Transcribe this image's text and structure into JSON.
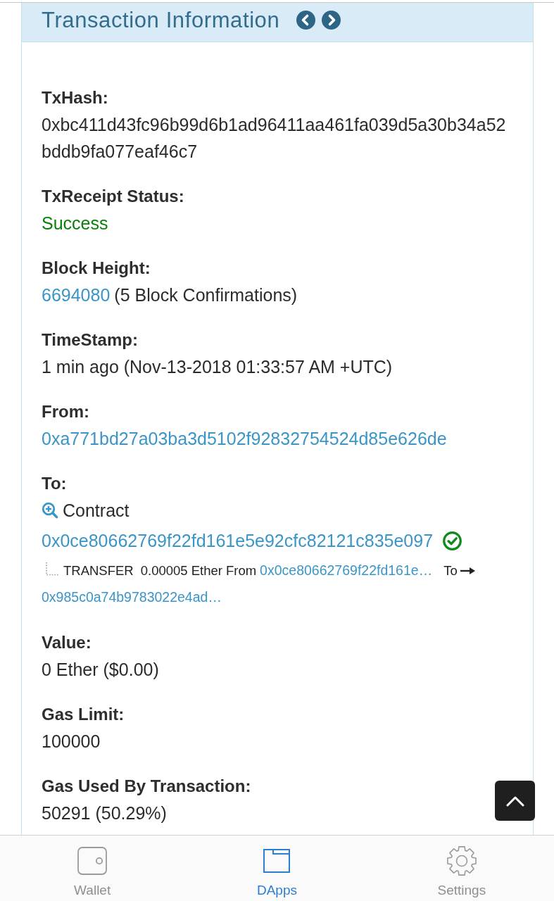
{
  "panel": {
    "title": "Transaction Information"
  },
  "fields": [
    {
      "kind": "text",
      "label": "TxHash:",
      "value": "0xbc411d43fc96b99d6b1ad96411aa461fa039d5a30b34a52bddb9fa077eaf46c7"
    },
    {
      "kind": "status",
      "label": "TxReceipt Status:",
      "value": "Success"
    },
    {
      "kind": "block",
      "label": "Block Height:",
      "link": "6694080",
      "note": "(5 Block Confirmations)"
    },
    {
      "kind": "text",
      "label": "TimeStamp:",
      "value": "1 min ago (Nov-13-2018 01:33:57 AM +UTC)"
    },
    {
      "kind": "address",
      "label": "From:",
      "link": "0xa771bd27a03ba3d5102f92832754524d85e626de"
    },
    {
      "kind": "contract",
      "label": "To:",
      "contract_label": "Contract",
      "link": "0x0ce80662769f22fd161e5e92cfc82121c835e097",
      "verified": true,
      "transfer": {
        "type": "TRANSFER",
        "amount": "0.00005 Ether",
        "from_label": "From",
        "from": "0x0ce80662769f22fd161e…",
        "to_label": "To",
        "to": "0x985c0a74b9783022e4ad…"
      }
    },
    {
      "kind": "text",
      "label": "Value:",
      "value": "0 Ether ($0.00)"
    },
    {
      "kind": "text",
      "label": "Gas Limit:",
      "value": "100000"
    },
    {
      "kind": "text",
      "label": "Gas Used By Transaction:",
      "value": "50291 (50.29%)"
    }
  ],
  "tabs": [
    {
      "label": "Wallet",
      "selected": false
    },
    {
      "label": "DApps",
      "selected": true
    },
    {
      "label": "Settings",
      "selected": false
    }
  ]
}
